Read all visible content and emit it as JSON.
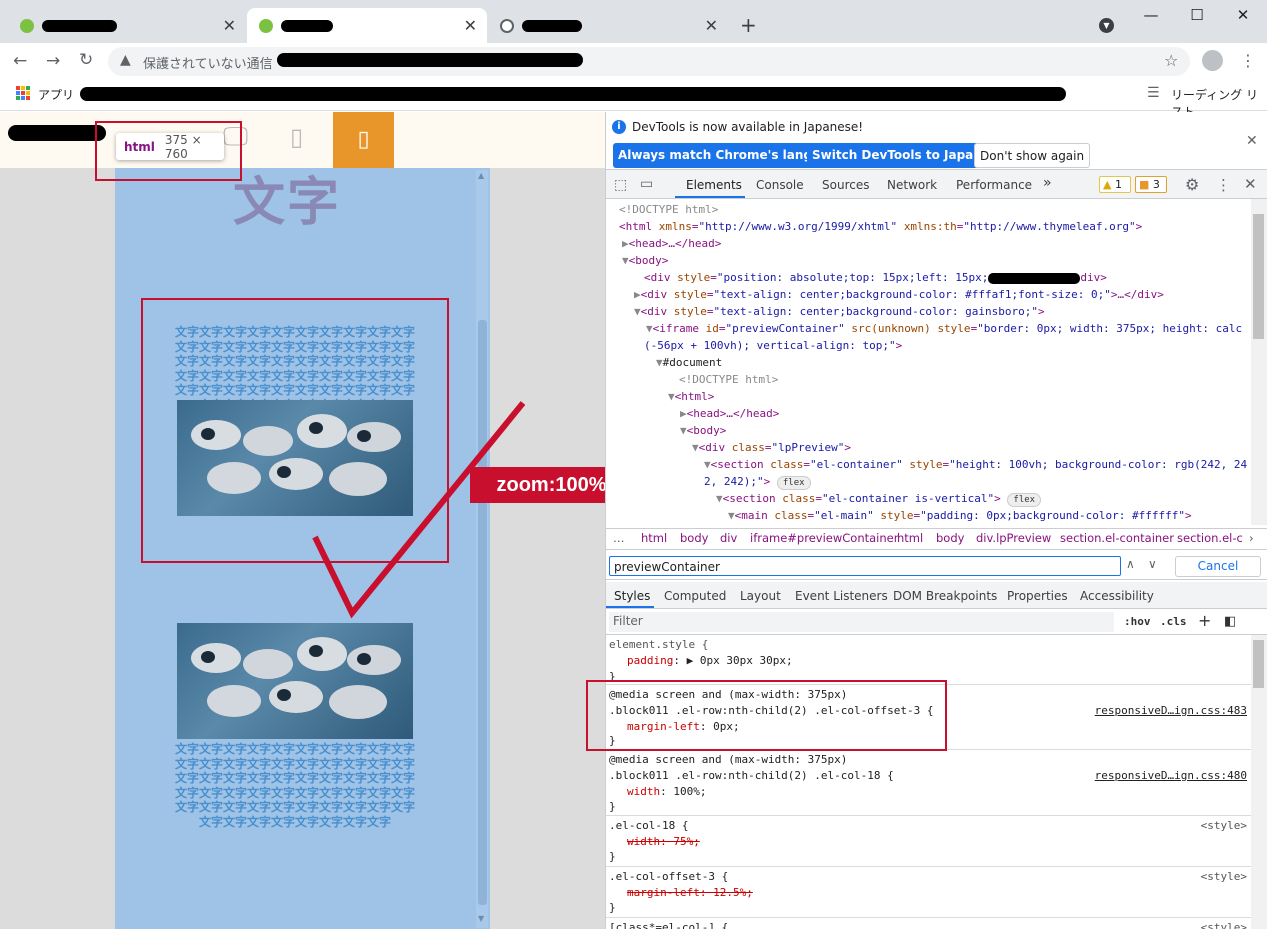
{
  "browser": {
    "tabs": [
      {
        "favicon_color": "#7cc242",
        "active": false
      },
      {
        "favicon_color": "#7cc242",
        "active": true
      },
      {
        "favicon_color": "#5f6368",
        "active": false
      }
    ],
    "new_tab_icon": "+",
    "window_controls": {
      "minimize": "—",
      "maximize": "☐",
      "close": "✕"
    },
    "omnibox": {
      "security_text": "保護されていない通信"
    },
    "bookmarks": {
      "apps_label": "アプリ",
      "reading_list_label": "リーディング リスト"
    }
  },
  "page": {
    "tooltip": {
      "tag": "html",
      "dims": "375 × 760"
    },
    "big_heading": "文字",
    "text_block": "文字文字文字文字文字文字文字文字文字文字文字文字文字文字文字文字文字文字文字文字文字文字文字文字文字文字文字文字文字文字文字文字文字文字文字文字文字文字文字文字文字文字文字文字文字文字文字文字文字文字文字文字文字文字文字文字文字文字",
    "zoom_label": "zoom:100%",
    "colors": {
      "accent_orange": "#e8962a",
      "annotation_red": "#c8102e",
      "preview_bg": "#9fc3e6"
    }
  },
  "devtools": {
    "info_text": "DevTools is now available in Japanese!",
    "btn_match": "Always match Chrome's language",
    "btn_switch": "Switch DevTools to Japanese",
    "btn_dont_show": "Don't show again",
    "tabs": [
      "Elements",
      "Console",
      "Sources",
      "Network",
      "Performance"
    ],
    "more_tabs": "»",
    "warnings": "1",
    "messages": "3",
    "dom": {
      "l1": "<!DOCTYPE html>",
      "l2_tag": "<html ",
      "l2_a1": "xmlns",
      "l2_v1": "\"http://www.w3.org/1999/xhtml\"",
      "l2_a2": "xmlns:th",
      "l2_v2": "\"http://www.thymeleaf.org\"",
      "l3": "<head>…</head>",
      "l4": "<body>",
      "l5_pre": "<div ",
      "l5_attr": "style",
      "l5_val": "\"position: absolute;top: 15px;left: 15px;",
      "l5_end": "div>",
      "l6_attr": "style",
      "l6_val": "\"text-align: center;background-color: #fffaf1;font-size: 0;\"",
      "l6_end": ">…</div>",
      "l7_attr": "style",
      "l7_val": "\"text-align: center;background-color: gainsboro;\"",
      "l8_a1": "id",
      "l8_v1": "\"previewContainer\"",
      "l8_src": "src(unknown)",
      "l8_a2": "style",
      "l8_v2": "\"border: 0px; width: 375px; height: calc",
      "l9": "(-56px + 100vh); vertical-align: top;\"",
      "l10": "#document",
      "l11": "<!DOCTYPE html>",
      "l12": "<html>",
      "l13": "<head>…</head>",
      "l14": "<body>",
      "l15_attr": "class",
      "l15_val": "\"lpPreview\"",
      "l16_a1": "class",
      "l16_v1": "\"el-container\"",
      "l16_a2": "style",
      "l16_v2": "\"height: 100vh; background-color: rgb(242, 24",
      "l17": "2, 242);\"",
      "l18_attr": "class",
      "l18_val": "\"el-container is-vertical\"",
      "l19_attr": "class",
      "l19_val": "\"el-main\"",
      "l19_a2": "style",
      "l19_v2": "\"padding: 0px;background-color: #ffffff\"",
      "flex": "flex"
    },
    "breadcrumbs": [
      "…",
      "html",
      "body",
      "div",
      "iframe#previewContainer",
      "html",
      "body",
      "div.lpPreview",
      "section.el-container",
      "section.el-c"
    ],
    "search_value": "previewContainer",
    "search_cancel": "Cancel",
    "pane_tabs": [
      "Styles",
      "Computed",
      "Layout",
      "Event Listeners",
      "DOM Breakpoints",
      "Properties",
      "Accessibility"
    ],
    "filter_placeholder": "Filter",
    "hov": ":hov",
    "cls": ".cls",
    "rules": {
      "r1_sel": "element.style {",
      "r1_prop": "padding",
      "r1_val": ": ▶ 0px 30px 30px;",
      "close": "}",
      "r2_media": "@media screen and (max-width: 375px)",
      "r2_sel": ".block011 .el-row:nth-child(2) .el-col-offset-3 {",
      "r2_prop": "margin-left",
      "r2_val": ": 0px;",
      "r2_src": "responsiveD…ign.css:483",
      "r3_media": "@media screen and (max-width: 375px)",
      "r3_sel": ".block011 .el-row:nth-child(2) .el-col-18 {",
      "r3_prop": "width",
      "r3_val": ": 100%;",
      "r3_src": "responsiveD…ign.css:480",
      "r4_sel": ".el-col-18 {",
      "r4_decl": "width: 75%;",
      "r4_src": "<style>",
      "r5_sel": ".el-col-offset-3 {",
      "r5_decl": "margin-left: 12.5%;",
      "r5_src": "<style>",
      "r6_sel": "[class*=el-col-] {",
      "r6_src": "<style>"
    }
  }
}
